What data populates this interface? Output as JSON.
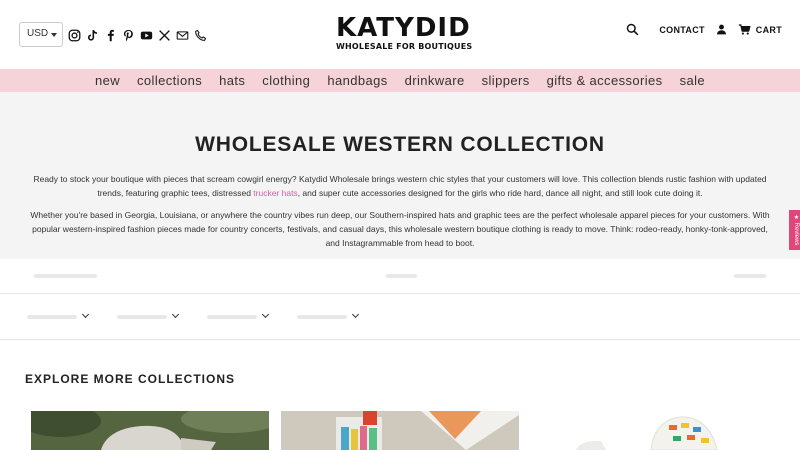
{
  "header": {
    "currency": "USD",
    "logo_main": "KATYDID",
    "logo_sub": "WHOLESALE FOR BOUTIQUES",
    "contact_label": "CONTACT",
    "cart_label": "CART",
    "social_icons": [
      "instagram-icon",
      "tiktok-icon",
      "facebook-icon",
      "pinterest-icon",
      "youtube-icon",
      "x-icon",
      "email-icon",
      "phone-icon"
    ]
  },
  "nav": {
    "items": [
      "new",
      "collections",
      "hats",
      "clothing",
      "handbags",
      "drinkware",
      "slippers",
      "gifts & accessories",
      "sale"
    ]
  },
  "intro": {
    "title": "WHOLESALE WESTERN COLLECTION",
    "p1_a": "Ready to stock your boutique with pieces that scream cowgirl energy? Katydid Wholesale brings western chic styles that your customers will love. This collection blends rustic fashion with updated trends, featuring graphic tees, distressed ",
    "p1_link": "trucker hats",
    "p1_b": ", and super cute accessories designed for the girls who ride hard, dance all night, and still look cute doing it.",
    "p2": "Whether you're based in Georgia, Louisiana, or anywhere the country vibes run deep, our Southern-inspired hats and graphic tees are the perfect wholesale apparel pieces for your customers. With popular western-inspired fashion pieces made for country concerts, festivals, and casual days, this wholesale western boutique clothing is ready to move. Think: rodeo-ready, honky-tonk-approved, and Instagrammable from head to boot."
  },
  "reviews_tab": "★ Reviews",
  "explore": {
    "title": "EXPLORE MORE COLLECTIONS"
  },
  "colors": {
    "nav_bg": "#f5d3d8",
    "intro_bg": "#f4f4f5",
    "link": "#e05aa2",
    "reviews_tab": "#e0467a"
  }
}
